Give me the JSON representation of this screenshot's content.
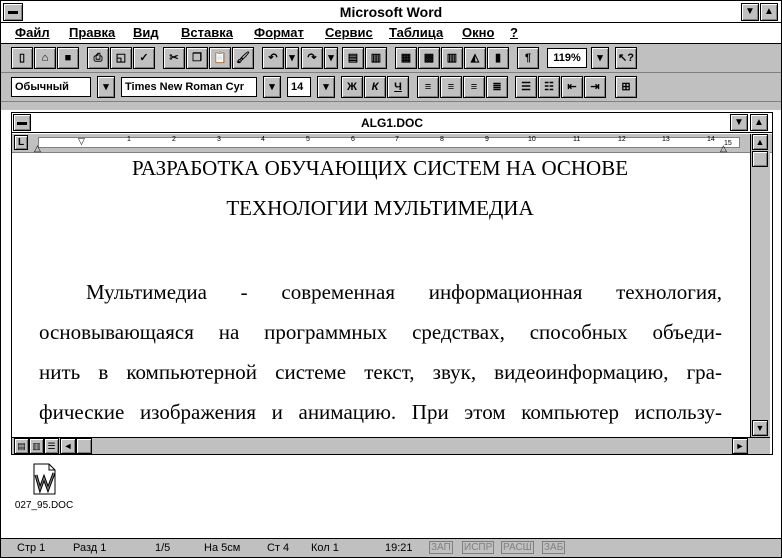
{
  "app_title": "Microsoft Word",
  "menu": [
    "Файл",
    "Правка",
    "Вид",
    "Вставка",
    "Формат",
    "Сервис",
    "Таблица",
    "Окно",
    "?"
  ],
  "zoom": "119%",
  "style": "Обычный",
  "font": "Times New Roman Cyr",
  "font_size": "14",
  "format_buttons": {
    "bold": "Ж",
    "italic": "К",
    "underline": "Ч"
  },
  "paragraph_mark": "¶",
  "document": {
    "title": "ALG1.DOC",
    "heading_line1": "РАЗРАБОТКА  ОБУЧАЮЩИХ СИСТЕМ НА ОСНОВЕ",
    "heading_line2": "ТЕХНОЛОГИИ МУЛЬТИМЕДИА",
    "lines": [
      "Мультимедиа - современная информационная технология,",
      "основывающаяся на программных средствах, способных объеди-",
      "нить в компьютерной системе текст, звук, видеоинформацию, гра-",
      "фические изображения и анимацию. При этом компьютер использу-"
    ]
  },
  "ruler_numbers": [
    "1",
    "2",
    "3",
    "4",
    "5",
    "6",
    "7",
    "8",
    "9",
    "10",
    "11",
    "12",
    "13",
    "14",
    "15"
  ],
  "desktop_icon": {
    "label": "027_95.DOC",
    "icon": "word-document-icon"
  },
  "status": {
    "page": "Стр  1",
    "section": "Разд  1",
    "page_of": "1/5",
    "at": "На 5см",
    "line": "Ст  4",
    "col": "Кол  1",
    "time": "19:21",
    "rec": "ЗАП",
    "mrk": "ИСПР",
    "ext": "РАСШ",
    "ovr": "ЗАБ"
  }
}
